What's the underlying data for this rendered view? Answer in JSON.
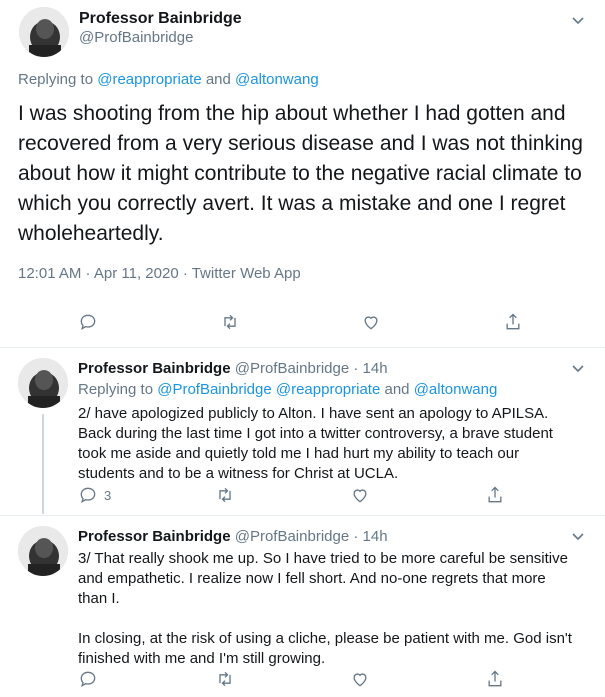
{
  "main": {
    "name": "Professor Bainbridge",
    "handle": "@ProfBainbridge",
    "replying_prefix": "Replying to",
    "replying_user1": "@reappropriate",
    "replying_and": "and",
    "replying_user2": "@altonwang",
    "text": "I was shooting from the hip about whether I had gotten and recovered from a very serious disease and I was not thinking about how it might contribute to the negative racial climate to which you correctly avert. It was a mistake and one I regret wholeheartedly.",
    "timestamp": "12:01 AM · Apr 11, 2020 · Twitter Web App"
  },
  "replies": [
    {
      "name": "Professor Bainbridge",
      "handle": "@ProfBainbridge",
      "time": "· 14h",
      "replying_prefix": "Replying to",
      "replying_user1": "@ProfBainbridge",
      "replying_user2": "@reappropriate",
      "replying_and": "and",
      "replying_user3": "@altonwang",
      "text": "2/  have apologized publicly to Alton. I have sent an apology to APILSA. Back during the last time I got into a twitter  controversy, a brave student took me aside and quietly told me I had hurt my ability to teach our students and to be a witness for Christ at UCLA.",
      "reply_count": "3"
    },
    {
      "name": "Professor Bainbridge",
      "handle": "@ProfBainbridge",
      "time": "· 14h",
      "text_p1": "3/ That really shook me up. So I have tried to be more careful be sensitive and empathetic. I realize now I fell short. And no-one regrets that more than I.",
      "text_p2": "In closing, at the risk of using a cliche, please be patient with me. God isn't finished with me and I'm still growing."
    }
  ]
}
